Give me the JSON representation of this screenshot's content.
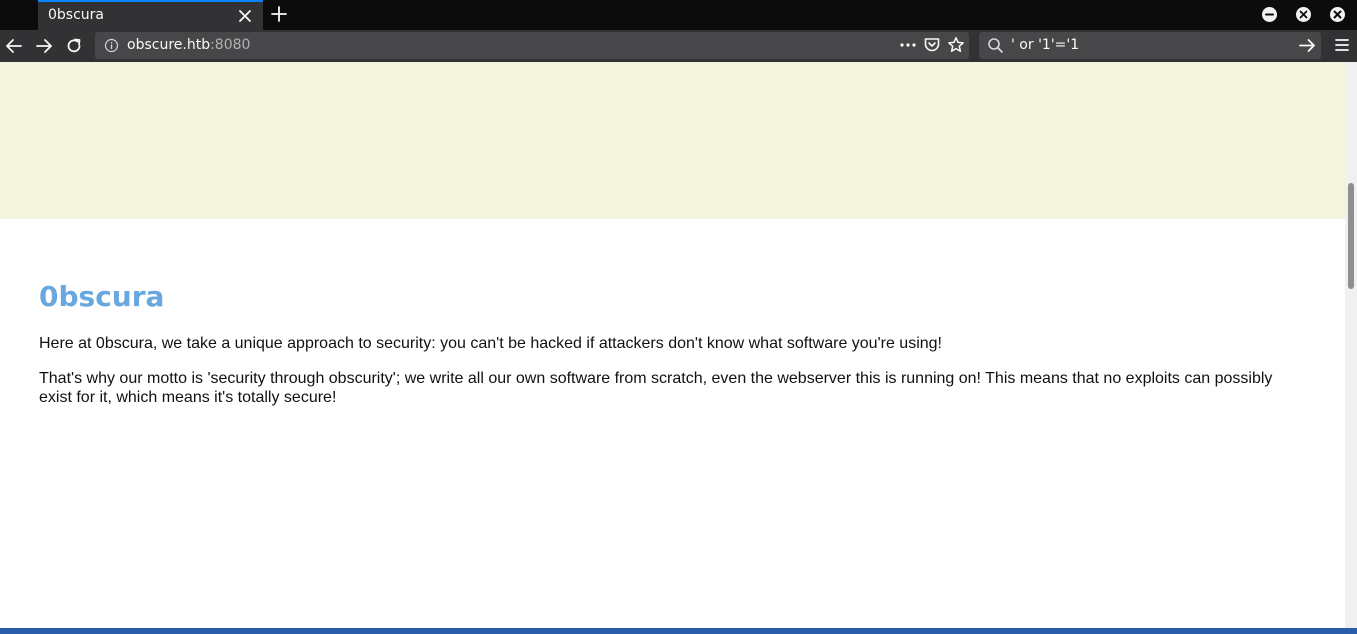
{
  "browser": {
    "tab_title": "0bscura",
    "url_host": "obscure.htb",
    "url_port": ":8080",
    "search_value": "' or '1'='1",
    "icons": {
      "back": "back-arrow-icon",
      "forward": "forward-arrow-icon",
      "reload": "reload-icon",
      "info": "info-icon",
      "page_actions": "ellipsis-icon",
      "pocket": "pocket-icon",
      "bookmark": "star-icon",
      "search": "search-icon",
      "search_go": "arrow-right-icon",
      "menu": "hamburger-menu-icon",
      "new_tab": "plus-icon",
      "close_tab": "close-icon",
      "minimize": "minimize-icon",
      "maximize": "maximize-icon",
      "close_window": "close-window-icon"
    },
    "colors": {
      "tab_accent": "#0a84ff",
      "chrome_dark": "#0c0c0d",
      "toolbar": "#323234"
    }
  },
  "page": {
    "title": "0bscura",
    "paragraphs": [
      "Here at 0bscura, we take a unique approach to security: you can't be hacked if attackers don't know what software you're using!",
      "That's why our motto is 'security through obscurity'; we write all our own software from scratch, even the webserver this is running on! This means that no exploits can possibly exist for it, which means it's totally secure!"
    ],
    "colors": {
      "banner": "#f3f5dc",
      "title": "#68a8e0",
      "text": "#111111"
    }
  }
}
